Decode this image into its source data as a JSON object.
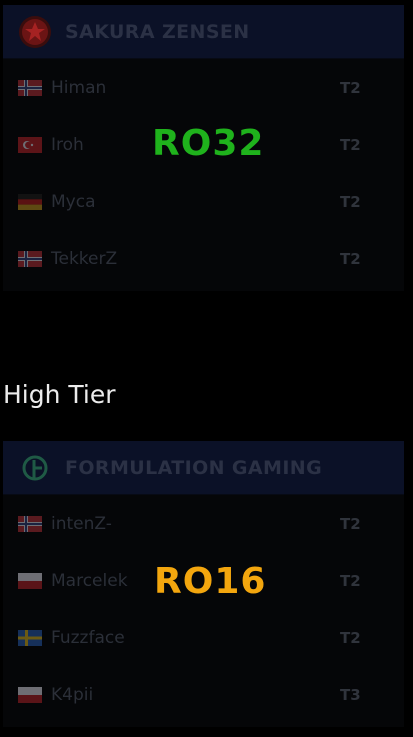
{
  "section_title": "High Tier",
  "colors": {
    "ro32": "#1fb21c",
    "ro16": "#f3a60e",
    "card_header": "#0b1127",
    "card_body": "#050608"
  },
  "teams": [
    {
      "name": "SAKURA ZENSEN",
      "logo": "sakura-zensen-logo",
      "round": "RO32",
      "players": [
        {
          "name": "Himan",
          "flag": "norway-flag",
          "tier": "T2"
        },
        {
          "name": "Iroh",
          "flag": "turkey-flag",
          "tier": "T2"
        },
        {
          "name": "Myca",
          "flag": "germany-flag",
          "tier": "T2"
        },
        {
          "name": "TekkerZ",
          "flag": "norway-flag",
          "tier": "T2"
        }
      ]
    },
    {
      "name": "FORMULATION GAMING",
      "logo": "formulation-gaming-logo",
      "round": "RO16",
      "players": [
        {
          "name": "intenZ-",
          "flag": "norway-flag",
          "tier": "T2"
        },
        {
          "name": "Marcelek",
          "flag": "poland-flag",
          "tier": "T2"
        },
        {
          "name": "Fuzzface",
          "flag": "sweden-flag",
          "tier": "T2"
        },
        {
          "name": "K4pii",
          "flag": "poland-flag",
          "tier": "T3"
        }
      ]
    }
  ]
}
